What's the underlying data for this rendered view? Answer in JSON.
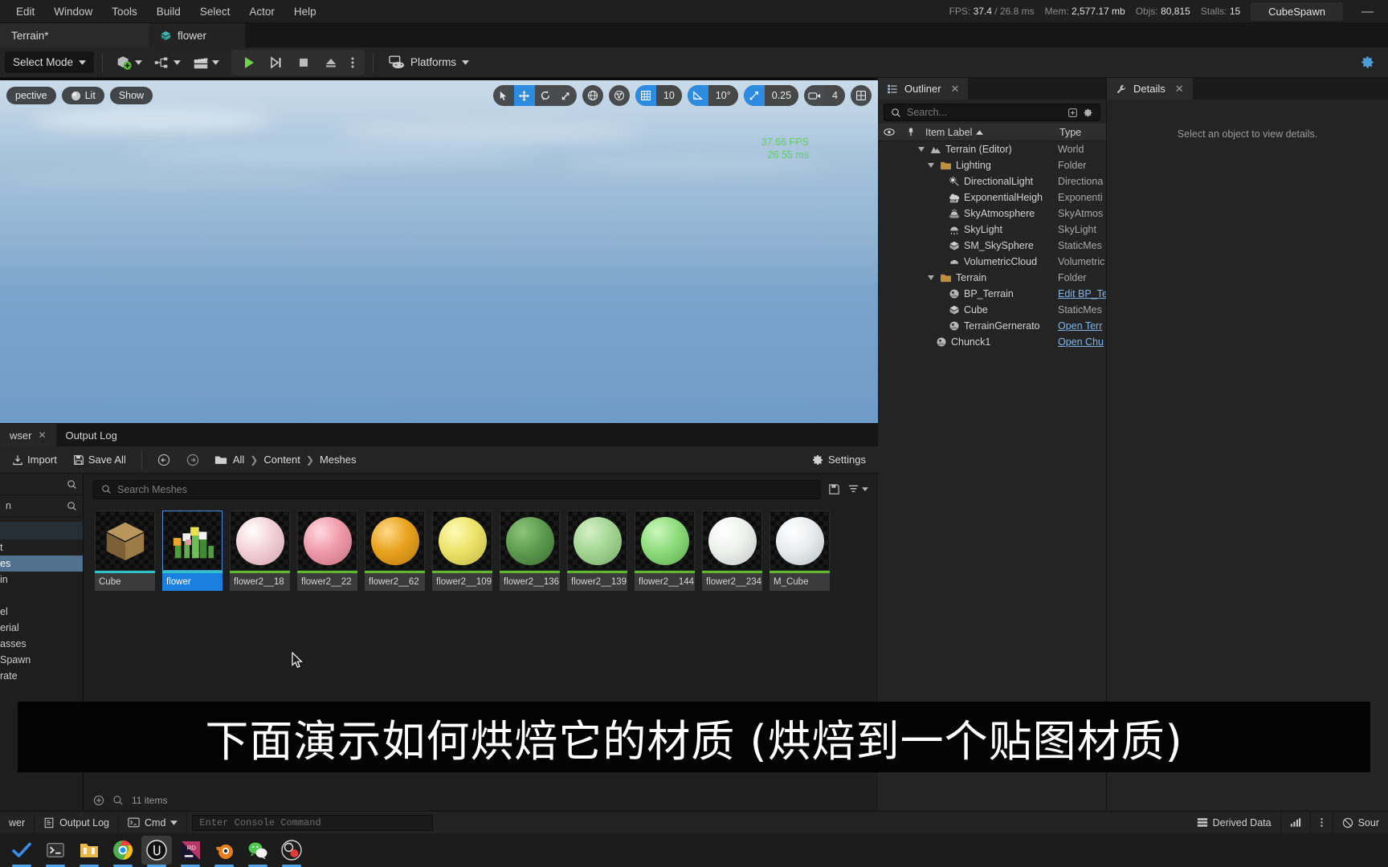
{
  "menubar": {
    "items": [
      "Edit",
      "Window",
      "Tools",
      "Build",
      "Select",
      "Actor",
      "Help"
    ],
    "stats": {
      "fps_label": "FPS:",
      "fps_value": "37.4",
      "fps_ms": "/ 26.8 ms",
      "mem_label": "Mem:",
      "mem_value": "2,577.17 mb",
      "objs_label": "Objs:",
      "objs_value": "80,815",
      "stalls_label": "Stalls:",
      "stalls_value": "15"
    },
    "project_badge": "CubeSpawn",
    "minimize": "—"
  },
  "tabs": [
    {
      "label": "Terrain*",
      "icon": "level-icon"
    },
    {
      "label": "flower",
      "icon": "staticmesh-icon"
    }
  ],
  "toolbar": {
    "select_mode": "Select Mode",
    "add_actor_tooltip": "Add Actor",
    "blueprints_tooltip": "Blueprints",
    "cinematics_tooltip": "Cinematics",
    "play": "Play",
    "skip": "Skip",
    "stop": "Stop",
    "eject": "Eject",
    "more": "More",
    "platforms": "Platforms"
  },
  "viewport": {
    "perspective": "pective",
    "lit": "Lit",
    "show": "Show",
    "transform_modes": [
      "select",
      "move",
      "rotate",
      "scale"
    ],
    "active_transform": "move",
    "world_coord": "world",
    "surface_snap": "surface-snap",
    "grid_snap_enabled": true,
    "grid_snap_value": "10",
    "angle_snap_enabled": true,
    "angle_snap_value": "10°",
    "scale_snap_enabled": true,
    "scale_snap_value": "0.25",
    "camera_speed": "4",
    "layouts": "layouts",
    "fps_overlay_1": "37.66 FPS",
    "fps_overlay_2": "26.55 ms"
  },
  "content_browser": {
    "tabs": [
      {
        "label": "wser",
        "active": true,
        "closable": true
      },
      {
        "label": "Output Log",
        "active": false,
        "closable": false
      }
    ],
    "toolbar": {
      "import": "Import",
      "save_all": "Save All",
      "settings": "Settings"
    },
    "breadcrumbs": [
      "All",
      "Content",
      "Meshes"
    ],
    "search_placeholder": "Search Meshes",
    "sidebar": {
      "search_placeholder_1": "",
      "search_placeholder_2": "n",
      "items": [
        {
          "label": "t",
          "selected": false
        },
        {
          "label": "es",
          "selected": true
        },
        {
          "label": "in",
          "selected": false
        },
        {
          "label": "",
          "selected": false
        },
        {
          "label": "el",
          "selected": false
        },
        {
          "label": "erial",
          "selected": false
        },
        {
          "label": "asses",
          "selected": false
        },
        {
          "label": "Spawn",
          "selected": false
        },
        {
          "label": "rate",
          "selected": false
        }
      ]
    },
    "assets": [
      {
        "name": "Cube",
        "kind": "cube",
        "color": "#a2844f",
        "bar": "#2ec3c9",
        "selected": false
      },
      {
        "name": "flower",
        "kind": "flower",
        "color": "#6fbf5a",
        "bar": "#2ec3c9",
        "selected": true
      },
      {
        "name": "flower2__18",
        "kind": "sphere",
        "color": "#f2d0d8",
        "bar": "#5eb82e",
        "selected": false
      },
      {
        "name": "flower2__22",
        "kind": "sphere",
        "color": "#ef9aaa",
        "bar": "#5eb82e",
        "selected": false
      },
      {
        "name": "flower2__62",
        "kind": "sphere",
        "color": "#e8a21e",
        "bar": "#5eb82e",
        "selected": false
      },
      {
        "name": "flower2__109",
        "kind": "sphere",
        "color": "#ece368",
        "bar": "#5eb82e",
        "selected": false
      },
      {
        "name": "flower2__136",
        "kind": "sphere",
        "color": "#5d9c50",
        "bar": "#5eb82e",
        "selected": false
      },
      {
        "name": "flower2__139",
        "kind": "sphere",
        "color": "#a4d694",
        "bar": "#5eb82e",
        "selected": false
      },
      {
        "name": "flower2__144",
        "kind": "sphere",
        "color": "#8ddc7b",
        "bar": "#5eb82e",
        "selected": false
      },
      {
        "name": "flower2__234",
        "kind": "sphere",
        "color": "#eef0ee",
        "bar": "#5eb82e",
        "selected": false
      },
      {
        "name": "M_Cube",
        "kind": "sphere",
        "color": "#e8ecef",
        "bar": "#5eb82e",
        "selected": false
      }
    ],
    "status_text": "11 items"
  },
  "outliner": {
    "title": "Outliner",
    "search_placeholder": "Search...",
    "columns": {
      "item_label": "Item Label",
      "type": "Type"
    },
    "rows": [
      {
        "indent": 1,
        "label": "Terrain (Editor)",
        "type": "World",
        "icon": "world-icon",
        "expander": true,
        "link": false
      },
      {
        "indent": 2,
        "label": "Lighting",
        "type": "Folder",
        "icon": "folder-icon",
        "expander": true,
        "link": false
      },
      {
        "indent": 3,
        "label": "DirectionalLight",
        "type": "Directiona",
        "icon": "dirlight-icon",
        "expander": false,
        "link": false
      },
      {
        "indent": 3,
        "label": "ExponentialHeigh",
        "type": "Exponenti",
        "icon": "fog-icon",
        "expander": false,
        "link": false
      },
      {
        "indent": 3,
        "label": "SkyAtmosphere",
        "type": "SkyAtmos",
        "icon": "skyatmo-icon",
        "expander": false,
        "link": false
      },
      {
        "indent": 3,
        "label": "SkyLight",
        "type": "SkyLight",
        "icon": "skylight-icon",
        "expander": false,
        "link": false
      },
      {
        "indent": 3,
        "label": "SM_SkySphere",
        "type": "StaticMes",
        "icon": "staticmesh-icon",
        "expander": false,
        "link": false
      },
      {
        "indent": 3,
        "label": "VolumetricCloud",
        "type": "Volumetric",
        "icon": "cloud-icon",
        "expander": false,
        "link": false
      },
      {
        "indent": 2,
        "label": "Terrain",
        "type": "Folder",
        "icon": "folder-icon",
        "expander": true,
        "link": false
      },
      {
        "indent": 3,
        "label": "BP_Terrain",
        "type": "Edit BP_Te",
        "icon": "blueprint-icon",
        "expander": false,
        "link": true
      },
      {
        "indent": 3,
        "label": "Cube",
        "type": "StaticMes",
        "icon": "staticmesh-icon",
        "expander": false,
        "link": false
      },
      {
        "indent": 3,
        "label": "TerrainGernerato",
        "type": "Open Terr",
        "icon": "blueprint-icon",
        "expander": false,
        "link": true
      },
      {
        "indent": 2,
        "label": "Chunck1",
        "type": "Open Chu",
        "icon": "blueprint-icon",
        "expander": false,
        "link": true
      }
    ]
  },
  "details": {
    "title": "Details",
    "empty_text": "Select an object to view details."
  },
  "subtitle": {
    "text": "下面演示如何烘焙它的材质 (烘焙到一个贴图材质)"
  },
  "statusbar": {
    "drawer": "wer",
    "output_log": "Output Log",
    "cmd": "Cmd",
    "console_placeholder": "Enter Console Command",
    "derived_data": "Derived Data",
    "source_control": "Sour"
  },
  "taskbar": {
    "items": [
      {
        "name": "todo-app",
        "color": "#3b8ce8",
        "glyph": "✔",
        "active": false,
        "running": true
      },
      {
        "name": "terminal-app",
        "color": "#cfcfcf",
        "glyph": "❯_",
        "active": false,
        "running": true
      },
      {
        "name": "files-app",
        "color": "#e8b84b",
        "glyph": "🗀",
        "active": false,
        "running": true
      },
      {
        "name": "chrome-browser",
        "color": "#4eaf56",
        "glyph": "◉",
        "active": false,
        "running": true
      },
      {
        "name": "unreal-engine",
        "color": "#ffffff",
        "glyph": "U",
        "active": true,
        "running": true
      },
      {
        "name": "rider-ide",
        "color": "#e8457c",
        "glyph": "RD",
        "active": false,
        "running": true
      },
      {
        "name": "blender-app",
        "color": "#e87d1e",
        "glyph": "◓",
        "active": false,
        "running": true
      },
      {
        "name": "wechat-app",
        "color": "#4ec94e",
        "glyph": "◕",
        "active": false,
        "running": true
      },
      {
        "name": "obs-studio",
        "color": "#d0d0d0",
        "glyph": "◉",
        "active": false,
        "running": true
      }
    ]
  },
  "colors": {
    "accent": "#2d8ce0",
    "selection": "#1b7fe0",
    "fps_green": "#5fd160",
    "link_blue": "#7fb4e6"
  }
}
